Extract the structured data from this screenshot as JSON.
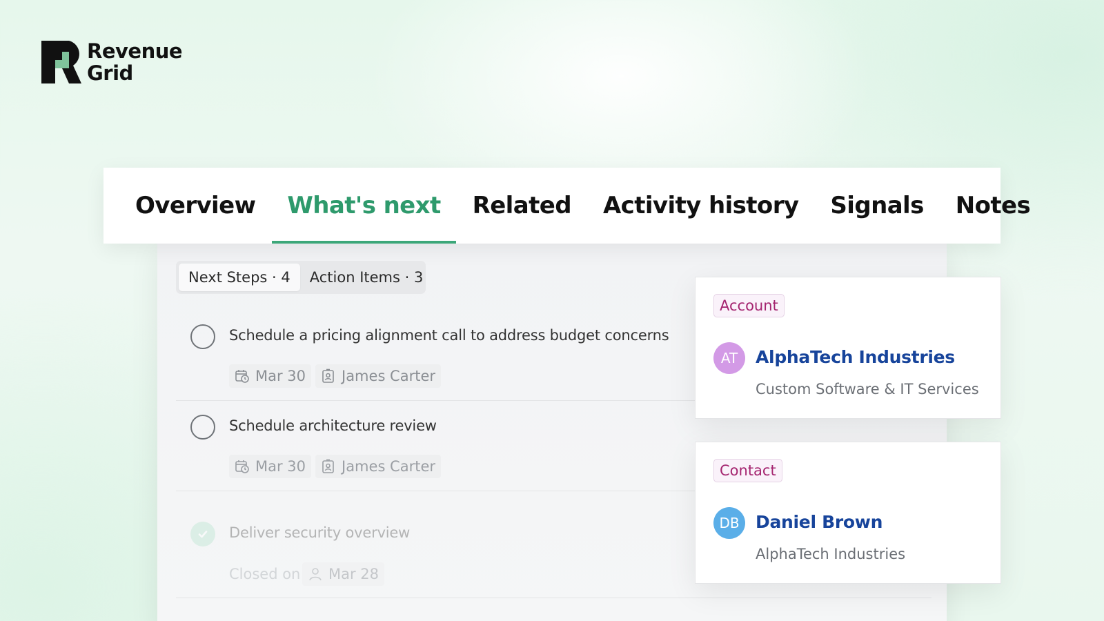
{
  "brand": {
    "line1": "Revenue",
    "line2": "Grid"
  },
  "tabs": [
    {
      "label": "Overview"
    },
    {
      "label": "What's next",
      "active": true
    },
    {
      "label": "Related"
    },
    {
      "label": "Activity history"
    },
    {
      "label": "Signals"
    },
    {
      "label": "Notes"
    }
  ],
  "segment": {
    "next_steps": "Next Steps · 4",
    "action_items": "Action Items  · 3"
  },
  "tasks": [
    {
      "title": "Schedule a pricing alignment call to address budget concerns",
      "date": "Mar 30",
      "owner": "James Carter",
      "done": false
    },
    {
      "title": "Schedule architecture review",
      "date": "Mar 30",
      "owner": "James Carter",
      "done": false
    },
    {
      "title": "Deliver security overview",
      "closed_label": "Closed on",
      "date": "Mar 28",
      "done": true
    }
  ],
  "account_card": {
    "badge": "Account",
    "initials": "AT",
    "avatar_color": "#d39ae6",
    "name": "AlphaTech Industries",
    "subtitle": "Custom Software & IT Services"
  },
  "contact_card": {
    "badge": "Contact",
    "initials": "DB",
    "avatar_color": "#5aaee8",
    "name": "Daniel Brown",
    "subtitle": "AlphaTech Industries"
  },
  "colors": {
    "accent": "#2e9a6c",
    "link": "#17449b",
    "badge": "#a4246f"
  }
}
